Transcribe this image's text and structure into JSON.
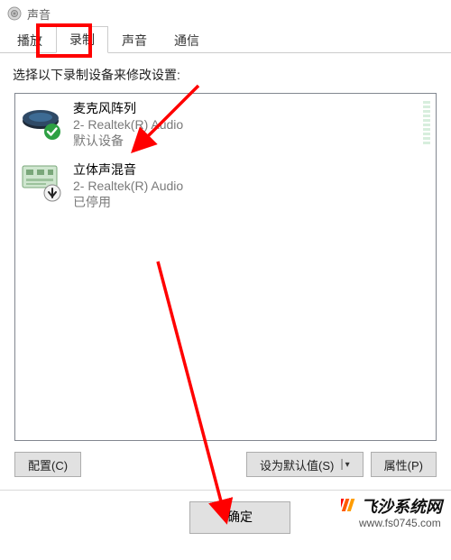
{
  "window": {
    "title": "声音"
  },
  "tabs": {
    "playback": "播放",
    "recording": "录制",
    "sounds": "声音",
    "communications": "通信"
  },
  "instruction": "选择以下录制设备来修改设置:",
  "devices": [
    {
      "name": "麦克风阵列",
      "sub": "2- Realtek(R) Audio",
      "status": "默认设备"
    },
    {
      "name": "立体声混音",
      "sub": "2- Realtek(R) Audio",
      "status": "已停用"
    }
  ],
  "buttons": {
    "configure": "配置(C)",
    "set_default": "设为默认值(S)",
    "properties": "属性(P)",
    "ok": "确定"
  },
  "watermark": {
    "brand": "飞沙系统网",
    "url": "www.fs0745.com"
  }
}
